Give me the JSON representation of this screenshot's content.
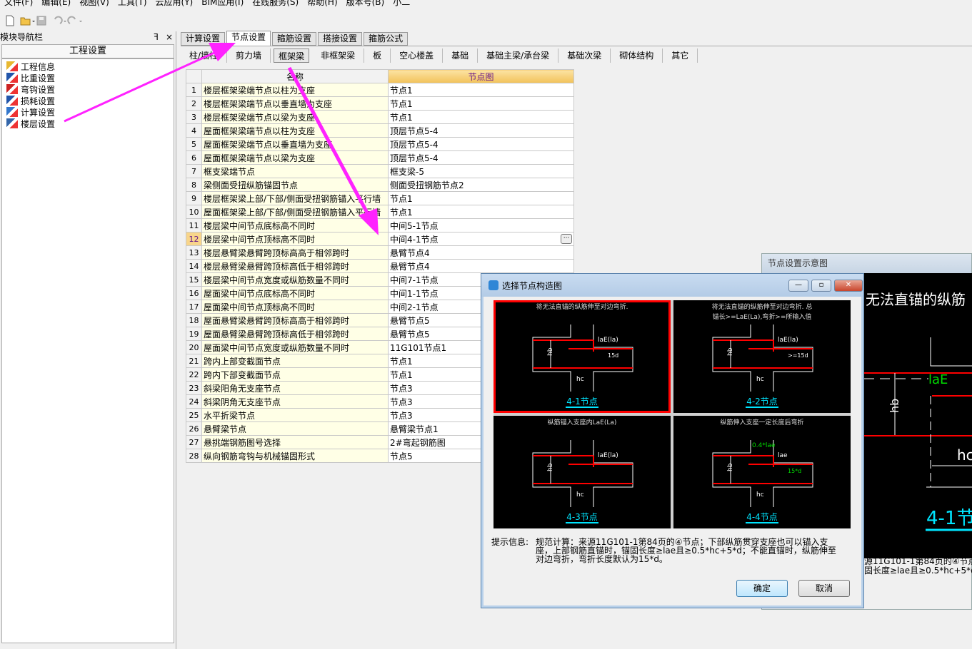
{
  "menu": [
    "文件(F)",
    "编辑(E)",
    "视图(V)",
    "工具(T)",
    "云应用(Y)",
    "BIM应用(I)",
    "在线服务(S)",
    "帮助(H)",
    "版本号(B)",
    "小二"
  ],
  "toolbar": {
    "icons": [
      "new-file-icon",
      "open-folder-icon",
      "save-icon",
      "undo-icon",
      "redo-icon"
    ]
  },
  "nav": {
    "title": "模块导航栏",
    "pin": "ꟻ",
    "close": "×",
    "header": "工程设置",
    "items": [
      {
        "label": "工程信息",
        "icon": "project-info-icon"
      },
      {
        "label": "比重设置",
        "icon": "density-icon"
      },
      {
        "label": "弯钩设置",
        "icon": "hook-icon"
      },
      {
        "label": "损耗设置",
        "icon": "loss-icon"
      },
      {
        "label": "计算设置",
        "icon": "calc-icon"
      },
      {
        "label": "楼层设置",
        "icon": "floor-icon"
      }
    ]
  },
  "tabs": [
    "计算设置",
    "节点设置",
    "箍筋设置",
    "搭接设置",
    "箍筋公式"
  ],
  "active_tab": "节点设置",
  "subtabs": [
    "柱/墙柱",
    "剪力墙",
    "框架梁",
    "非框架梁",
    "板",
    "空心楼盖",
    "基础",
    "基础主梁/承台梁",
    "基础次梁",
    "砌体结构",
    "其它"
  ],
  "active_subtab": "框架梁",
  "table": {
    "headers": [
      "",
      "名称",
      "节点图"
    ],
    "selected_row": 12,
    "rows": [
      [
        "1",
        "楼层框架梁端节点以柱为支座",
        "节点1"
      ],
      [
        "2",
        "楼层框架梁端节点以垂直墙为支座",
        "节点1"
      ],
      [
        "3",
        "楼层框架梁端节点以梁为支座",
        "节点1"
      ],
      [
        "4",
        "屋面框架梁端节点以柱为支座",
        "顶层节点5-4"
      ],
      [
        "5",
        "屋面框架梁端节点以垂直墙为支座",
        "顶层节点5-4"
      ],
      [
        "6",
        "屋面框架梁端节点以梁为支座",
        "顶层节点5-4"
      ],
      [
        "7",
        "框支梁端节点",
        "框支梁-5"
      ],
      [
        "8",
        "梁侧面受扭纵筋锚固节点",
        "侧面受扭钢筋节点2"
      ],
      [
        "9",
        "楼层框架梁上部/下部/侧面受扭钢筋锚入平行墙",
        "节点1"
      ],
      [
        "10",
        "屋面框架梁上部/下部/侧面受扭钢筋锚入平行墙",
        "节点1"
      ],
      [
        "11",
        "楼层梁中间节点底标高不同时",
        "中间5-1节点"
      ],
      [
        "12",
        "楼层梁中间节点顶标高不同时",
        "中间4-1节点"
      ],
      [
        "13",
        "楼层悬臂梁悬臂跨顶标高高于相邻跨时",
        "悬臂节点4"
      ],
      [
        "14",
        "楼层悬臂梁悬臂跨顶标高低于相邻跨时",
        "悬臂节点4"
      ],
      [
        "15",
        "楼层梁中间节点宽度或纵筋数量不同时",
        "中间7-1节点"
      ],
      [
        "16",
        "屋面梁中间节点底标高不同时",
        "中间1-1节点"
      ],
      [
        "17",
        "屋面梁中间节点顶标高不同时",
        "中间2-1节点"
      ],
      [
        "18",
        "屋面悬臂梁悬臂跨顶标高高于相邻跨时",
        "悬臂节点5"
      ],
      [
        "19",
        "屋面悬臂梁悬臂跨顶标高低于相邻跨时",
        "悬臂节点5"
      ],
      [
        "20",
        "屋面梁中间节点宽度或纵筋数量不同时",
        "11G101节点1"
      ],
      [
        "21",
        "跨内上部变截面节点",
        "节点1"
      ],
      [
        "22",
        "跨内下部变截面节点",
        "节点1"
      ],
      [
        "23",
        "斜梁阳角无支座节点",
        "节点3"
      ],
      [
        "24",
        "斜梁阴角无支座节点",
        "节点3"
      ],
      [
        "25",
        "水平折梁节点",
        "节点3"
      ],
      [
        "26",
        "悬臂梁节点",
        "悬臂梁节点1"
      ],
      [
        "27",
        "悬挑端钢筋图号选择",
        "2#弯起钢筋图"
      ],
      [
        "28",
        "纵向钢筋弯钩与机械锚固形式",
        "节点5"
      ]
    ],
    "ellipsis": "···"
  },
  "preview": {
    "title": "节点设置示意图",
    "heading": "无法直锚的纵筋",
    "labels": {
      "hb": "hb",
      "lae": "laE",
      "hc": "hc"
    },
    "caption": "4-1节",
    "text1": "源11G101-1第84页的④节点；",
    "text2": "固长度≥lae且≥0.5*hc+5*d"
  },
  "dialog": {
    "title": "选择节点构造图",
    "min": "—",
    "max": "▫",
    "close": "✕",
    "options": [
      {
        "title1": "将无法直锚的纵筋伸至对边弯折.",
        "title2": "",
        "caption": "4-1节点",
        "l1": "laE(la)",
        "l2": "15d",
        "selected": true
      },
      {
        "title1": "将无法直锚的纵筋伸至对边弯折. 总",
        "title2": "锚长>=LaE(La),弯折>=所输入值",
        "caption": "4-2节点",
        "l1": "laE(la)",
        "l2": ">=15d",
        "selected": false
      },
      {
        "title1": "纵筋锚入支座内LaE(La)",
        "title2": "",
        "caption": "4-3节点",
        "l1": "laE(la)",
        "l2": "",
        "selected": false
      },
      {
        "title1": "纵筋伸入支座一定长度后弯折",
        "title2": "",
        "caption": "4-4节点",
        "l1": "lae",
        "l2": "15*d",
        "l3": "0.4*lae",
        "selected": false
      }
    ],
    "hb": "hb",
    "hc": "hc",
    "hint_label": "提示信息:",
    "hint": "规范计算：来源11G101-1第84页的④节点；下部纵筋贯穿支座也可以锚入支座，上部钢筋直锚时，锚固长度≥lae且≥0.5*hc+5*d；不能直锚时，纵筋伸至对边弯折，弯折长度默认为15*d。",
    "ok": "确定",
    "cancel": "取消"
  },
  "colors": {
    "annotation_arrow": "#ff22ff",
    "rebar": "#ff0000",
    "caption": "#00e5ff",
    "green_label": "#00dd00",
    "header_gradient": "#f2c25a"
  }
}
